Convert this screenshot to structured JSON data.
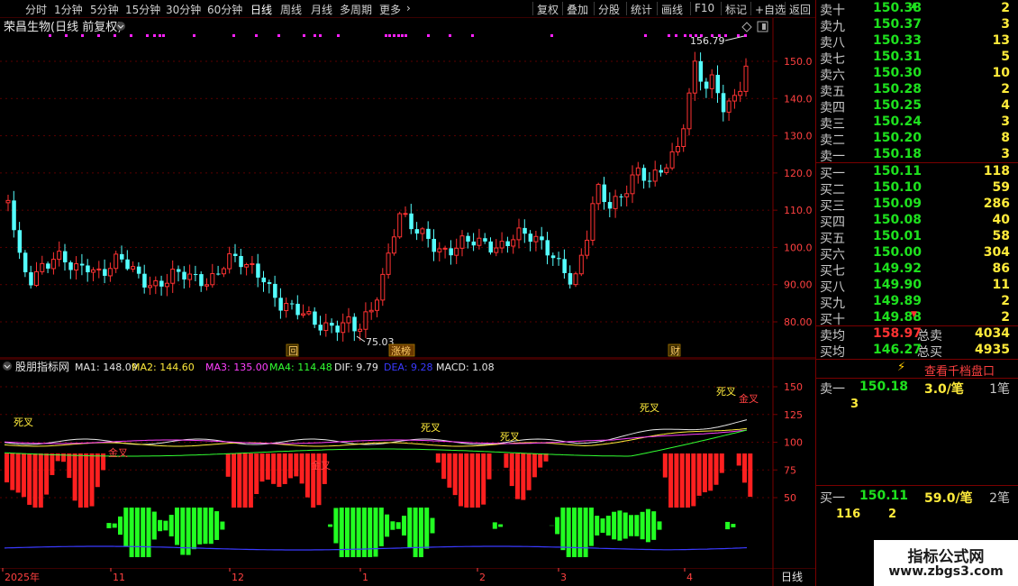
{
  "toolbar": {
    "periods": [
      "分时",
      "1分钟",
      "5分钟",
      "15分钟",
      "30分钟",
      "60分钟",
      "日线",
      "周线",
      "月线",
      "多周期",
      "更多"
    ],
    "active": "日线",
    "more_icon": "chevron-right-icon",
    "actions": [
      "复权",
      "叠加",
      "分股",
      "统计",
      "画线",
      "F10",
      "标记",
      "+自选",
      "返回"
    ]
  },
  "main_chart": {
    "title": "荣昌生物(日线 前复权)",
    "title_icon": "chevron-down-icon",
    "high_label": "156.79",
    "low_label": "75.03",
    "markers": [
      "回",
      "涨榜",
      "财"
    ],
    "y_ticks": [
      150,
      140,
      130,
      120,
      110,
      100,
      90,
      80
    ],
    "y_tick_labels": [
      "150.0",
      "140.0",
      "130.0",
      "120.0",
      "110.0",
      "100.0",
      "90.00",
      "80.00"
    ],
    "colors": {
      "up": "#ff3232",
      "down": "#54ffff",
      "grid": "#5a0000",
      "axis": "#7a0000"
    }
  },
  "indicator": {
    "name": "股朋指标网",
    "values": [
      {
        "label": "MA1: 148.09",
        "color": "#e6e6e6"
      },
      {
        "label": "MA2: 144.60",
        "color": "#ffeb3b"
      },
      {
        "label": "MA3: 135.00",
        "color": "#ff40ff"
      },
      {
        "label": "MA4: 114.48",
        "color": "#32ff32"
      },
      {
        "label": "DIF: 9.79",
        "color": "#e6e6e6"
      },
      {
        "label": "DEA: 9.28",
        "color": "#3a3aff"
      },
      {
        "label": "MACD: 1.08",
        "color": "#e6e6e6"
      }
    ],
    "y_ticks": [
      150,
      125,
      100,
      75,
      50
    ],
    "y_tick_labels": [
      "150.0",
      "125.0",
      "100.0",
      "75.00",
      "50.00"
    ],
    "signal_dead": "死叉",
    "signal_gold": "金叉"
  },
  "time_axis": {
    "labels": [
      "2025年",
      "11",
      "12",
      "1",
      "2",
      "3",
      "4"
    ],
    "period": "日线"
  },
  "order_book": {
    "asks": [
      {
        "label": "卖十",
        "price": "150.38",
        "vol": "2",
        "mark": "up"
      },
      {
        "label": "卖九",
        "price": "150.37",
        "vol": "3",
        "mark": ""
      },
      {
        "label": "卖八",
        "price": "150.33",
        "vol": "13",
        "mark": ""
      },
      {
        "label": "卖七",
        "price": "150.31",
        "vol": "5",
        "mark": ""
      },
      {
        "label": "卖六",
        "price": "150.30",
        "vol": "10",
        "mark": ""
      },
      {
        "label": "卖五",
        "price": "150.28",
        "vol": "2",
        "mark": ""
      },
      {
        "label": "卖四",
        "price": "150.25",
        "vol": "4",
        "mark": ""
      },
      {
        "label": "卖三",
        "price": "150.24",
        "vol": "3",
        "mark": ""
      },
      {
        "label": "卖二",
        "price": "150.20",
        "vol": "8",
        "mark": ""
      },
      {
        "label": "卖一",
        "price": "150.18",
        "vol": "3",
        "mark": ""
      }
    ],
    "bids": [
      {
        "label": "买一",
        "price": "150.11",
        "vol": "118",
        "mark": ""
      },
      {
        "label": "买二",
        "price": "150.10",
        "vol": "59",
        "mark": ""
      },
      {
        "label": "买三",
        "price": "150.09",
        "vol": "286",
        "mark": ""
      },
      {
        "label": "买四",
        "price": "150.08",
        "vol": "40",
        "mark": ""
      },
      {
        "label": "买五",
        "price": "150.01",
        "vol": "58",
        "mark": ""
      },
      {
        "label": "买六",
        "price": "150.00",
        "vol": "304",
        "mark": ""
      },
      {
        "label": "买七",
        "price": "149.92",
        "vol": "86",
        "mark": ""
      },
      {
        "label": "买八",
        "price": "149.90",
        "vol": "11",
        "mark": ""
      },
      {
        "label": "买九",
        "price": "149.89",
        "vol": "2",
        "mark": ""
      },
      {
        "label": "买十",
        "price": "149.88",
        "vol": "2",
        "mark": "down"
      }
    ],
    "avg_sell": {
      "label": "卖均",
      "price": "158.97",
      "total_label": "总卖",
      "total": "4034"
    },
    "avg_buy": {
      "label": "买均",
      "price": "146.27",
      "total_label": "总买",
      "total": "4935"
    },
    "depth_button": "查看千档盘口",
    "depth_icon": "lightning-icon",
    "sell1": {
      "label": "卖一",
      "price": "150.18",
      "per": "3.0/笔",
      "count": "1笔",
      "sub": "3"
    },
    "buy1": {
      "label": "买一",
      "price": "150.11",
      "per": "59.0/笔",
      "count": "2笔",
      "sub1": "116",
      "sub2": "2"
    }
  },
  "watermark": {
    "line1": "指标公式网",
    "line2": "www.zbgs3.com"
  }
}
